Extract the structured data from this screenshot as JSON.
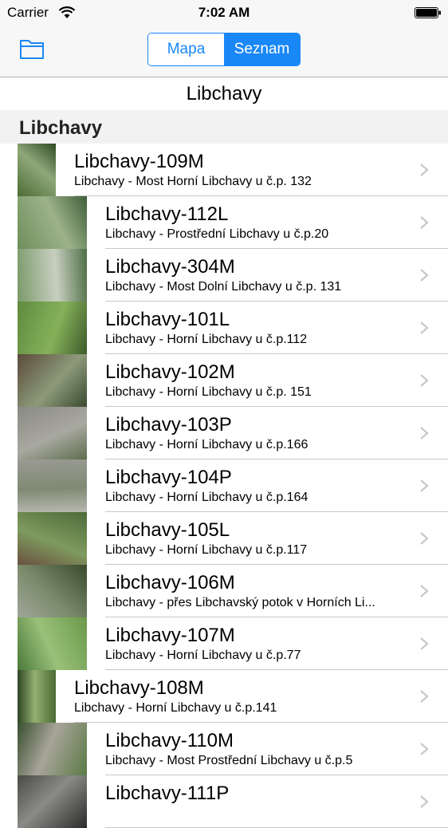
{
  "status_bar": {
    "carrier": "Carrier",
    "time": "7:02 AM"
  },
  "nav": {
    "segments": [
      "Mapa",
      "Seznam"
    ],
    "selected": "Seznam",
    "accent": "#1a87f6"
  },
  "title": "Libchavy",
  "section": "Libchavy",
  "rows": [
    {
      "title": "Libchavy-109M",
      "subtitle": "Libchavy - Most Horní Libchavy u č.p. 132",
      "thumb": [
        "#4d6b35",
        "#8fa87a",
        "#2e4a22"
      ]
    },
    {
      "title": "Libchavy-112L",
      "subtitle": "Libchavy - Prostřední Libchavy u č.p.20",
      "thumb": [
        "#6e8f5c",
        "#9db289",
        "#3f5f3a"
      ]
    },
    {
      "title": "Libchavy-304M",
      "subtitle": "Libchavy - Most Dolní Libchavy u č.p. 131",
      "thumb": [
        "#7a9a6a",
        "#c8cfc0",
        "#4f6f45"
      ]
    },
    {
      "title": "Libchavy-101L",
      "subtitle": "Libchavy - Horní Libchavy u č.p.112",
      "thumb": [
        "#5f8a3e",
        "#86b15a",
        "#3c5a2a"
      ]
    },
    {
      "title": "Libchavy-102M",
      "subtitle": "Libchavy - Horní Libchavy u č.p. 151",
      "thumb": [
        "#5b4a3a",
        "#8c9a7a",
        "#3a4a30"
      ]
    },
    {
      "title": "Libchavy-103P",
      "subtitle": "Libchavy - Horní Libchavy u č.p.166",
      "thumb": [
        "#8a8a84",
        "#a8a8a0",
        "#5e6e4e"
      ]
    },
    {
      "title": "Libchavy-104P",
      "subtitle": "Libchavy - Horní Libchavy u č.p.164",
      "thumb": [
        "#9a9a94",
        "#7f8a74",
        "#b8b8b0"
      ]
    },
    {
      "title": "Libchavy-105L",
      "subtitle": "Libchavy - Horní Libchavy u č.p.117",
      "thumb": [
        "#4e6a3a",
        "#7e9a5e",
        "#6a5040"
      ]
    },
    {
      "title": "Libchavy-106M",
      "subtitle": "Libchavy - přes Libchavský potok v Horních Li...",
      "thumb": [
        "#3a4a2e",
        "#7a8a6a",
        "#a0a69a"
      ]
    },
    {
      "title": "Libchavy-107M",
      "subtitle": "Libchavy - Horní Libchavy u č.p.77",
      "thumb": [
        "#6a9a4a",
        "#9ac07a",
        "#4a7a3a"
      ]
    },
    {
      "title": "Libchavy-108M",
      "subtitle": "Libchavy - Horní Libchavy u č.p.141",
      "thumb": [
        "#4a6a34",
        "#94b070",
        "#2e4422"
      ]
    },
    {
      "title": "Libchavy-110M",
      "subtitle": "Libchavy - Most Prostřední Libchavy u č.p.5",
      "thumb": [
        "#5a7a44",
        "#a8a49a",
        "#3a5030"
      ]
    },
    {
      "title": "Libchavy-111P",
      "subtitle": "",
      "thumb": [
        "#2a2a2a",
        "#8a8a86",
        "#4a4a48"
      ]
    }
  ]
}
